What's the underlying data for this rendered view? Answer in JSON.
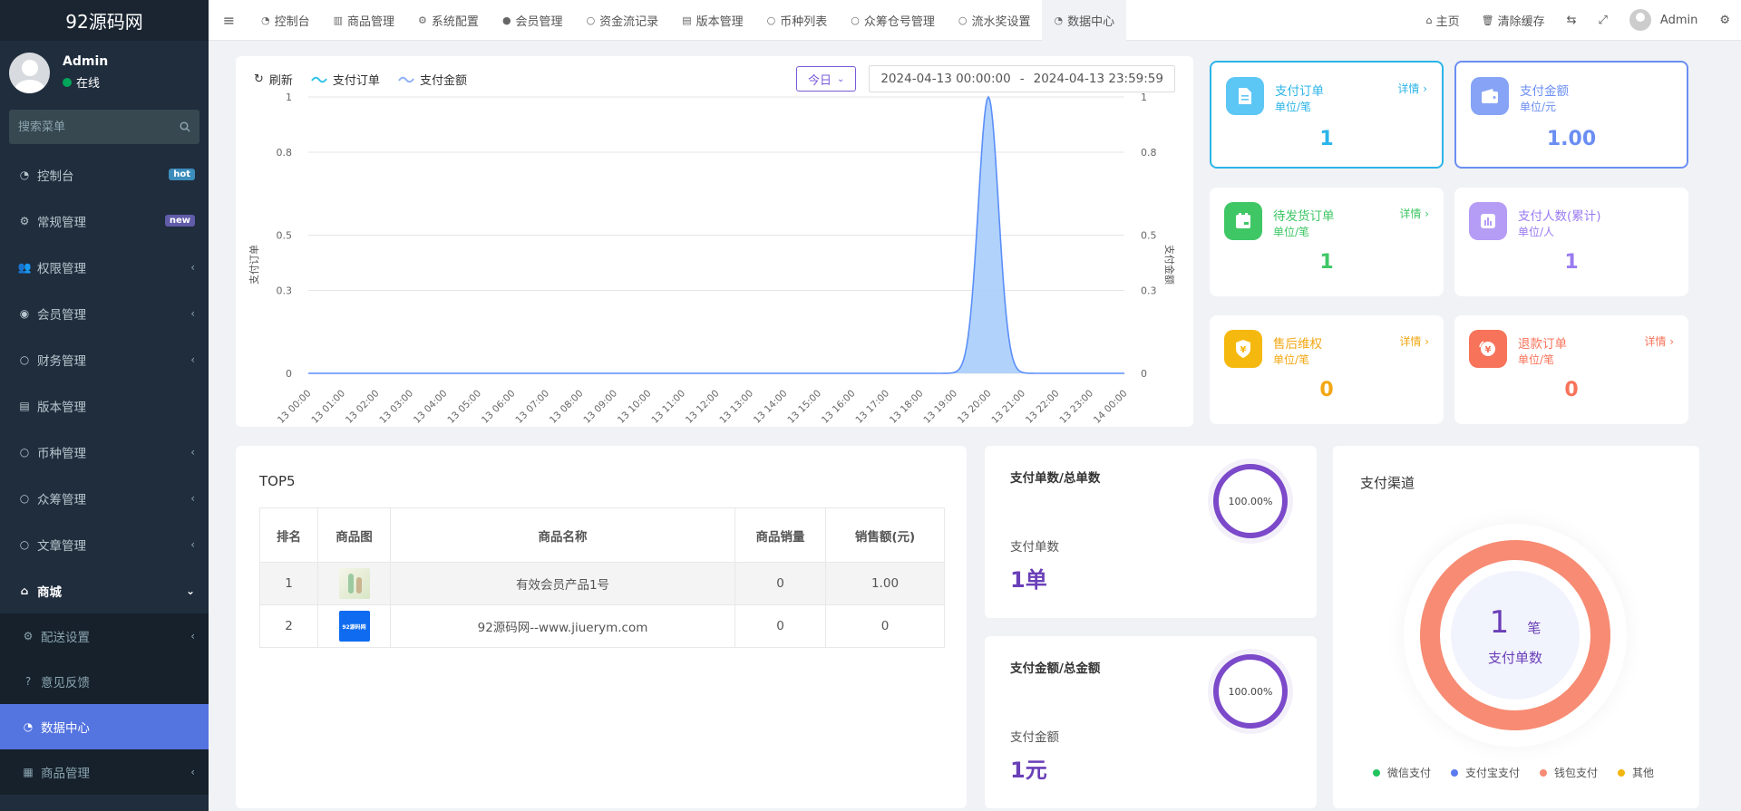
{
  "sidebar": {
    "logo": "92源码网",
    "user": {
      "name": "Admin",
      "status": "在线"
    },
    "search_placeholder": "搜索菜单",
    "items": [
      {
        "label": "控制台",
        "badge": "hot"
      },
      {
        "label": "常规管理",
        "badge": "new"
      },
      {
        "label": "权限管理"
      },
      {
        "label": "会员管理"
      },
      {
        "label": "财务管理"
      },
      {
        "label": "版本管理"
      },
      {
        "label": "币种管理"
      },
      {
        "label": "众筹管理"
      },
      {
        "label": "文章管理"
      },
      {
        "label": "商城"
      }
    ],
    "sub_items": [
      {
        "label": "配送设置"
      },
      {
        "label": "意见反馈"
      },
      {
        "label": "数据中心"
      },
      {
        "label": "商品管理"
      }
    ]
  },
  "navbar": {
    "tabs": [
      "控制台",
      "商品管理",
      "系统配置",
      "会员管理",
      "资金流记录",
      "版本管理",
      "币种列表",
      "众筹仓号管理",
      "流水奖设置",
      "数据中心"
    ],
    "right": {
      "home": "主页",
      "clear_cache": "清除缓存",
      "user": "Admin"
    }
  },
  "chart": {
    "refresh_label": "刷新",
    "legend": [
      "支付订单",
      "支付金额"
    ],
    "period": "今日",
    "date_start": "2024-04-13 00:00:00",
    "date_sep": "-",
    "date_end": "2024-04-13 23:59:59",
    "ylabel_left": "支付订单",
    "ylabel_right": "支付金额"
  },
  "chart_data": {
    "type": "area",
    "x": [
      "13 00:00",
      "13 01:00",
      "13 02:00",
      "13 03:00",
      "13 04:00",
      "13 05:00",
      "13 06:00",
      "13 07:00",
      "13 08:00",
      "13 09:00",
      "13 10:00",
      "13 11:00",
      "13 12:00",
      "13 13:00",
      "13 14:00",
      "13 15:00",
      "13 16:00",
      "13 17:00",
      "13 18:00",
      "13 19:00",
      "13 20:00",
      "13 21:00",
      "13 22:00",
      "13 23:00",
      "14 00:00"
    ],
    "series": [
      {
        "name": "支付订单",
        "values": [
          0,
          0,
          0,
          0,
          0,
          0,
          0,
          0,
          0,
          0,
          0,
          0,
          0,
          0,
          0,
          0,
          0,
          0,
          0,
          0,
          1,
          0,
          0,
          0,
          0
        ]
      },
      {
        "name": "支付金额",
        "values": [
          0,
          0,
          0,
          0,
          0,
          0,
          0,
          0,
          0,
          0,
          0,
          0,
          0,
          0,
          0,
          0,
          0,
          0,
          0,
          0,
          1,
          0,
          0,
          0,
          0
        ]
      }
    ],
    "yticks": [
      "0",
      "0.3",
      "0.5",
      "0.8",
      "1"
    ],
    "ylim": [
      0,
      1
    ],
    "xlabel": "",
    "ylabel": "支付订单",
    "grid": true,
    "colors": {
      "line": "#5b8ff9",
      "fill": "#a9cdfb"
    }
  },
  "stats": [
    {
      "title": "支付订单",
      "unit": "单位/笔",
      "detail": "详情",
      "value": "1",
      "color": "#2bb4e9",
      "icon": "document-icon"
    },
    {
      "title": "支付金额",
      "unit": "单位/元",
      "detail": "",
      "value": "1.00",
      "color": "#6b8ef3",
      "icon": "wallet-icon"
    },
    {
      "title": "待发货订单",
      "unit": "单位/笔",
      "detail": "详情",
      "value": "1",
      "color": "#3fc765",
      "icon": "package-icon"
    },
    {
      "title": "支付人数(累计)",
      "unit": "单位/人",
      "detail": "",
      "value": "1",
      "color": "#9a7bf0",
      "icon": "bar-chart-icon"
    },
    {
      "title": "售后维权",
      "unit": "单位/笔",
      "detail": "详情",
      "value": "0",
      "color": "#f2a713",
      "icon": "shield-yuan-icon"
    },
    {
      "title": "退款订单",
      "unit": "单位/笔",
      "detail": "详情",
      "value": "0",
      "color": "#f7735a",
      "icon": "refund-icon"
    }
  ],
  "top5": {
    "title": "TOP5",
    "headers": [
      "排名",
      "商品图",
      "商品名称",
      "商品销量",
      "销售额(元)"
    ],
    "rows": [
      {
        "rank": "1",
        "name": "有效会员产品1号",
        "sales": "0",
        "amount": "1.00"
      },
      {
        "rank": "2",
        "name": "92源码网--www.jiuerym.com",
        "sales": "0",
        "amount": "0"
      }
    ],
    "thumb2_text": "92源码网"
  },
  "ratio_orders": {
    "title": "支付单数/总单数",
    "percent": "100.00%",
    "label": "支付单数",
    "value": "1单"
  },
  "ratio_amount": {
    "title": "支付金额/总金额",
    "percent": "100.00%",
    "label": "支付金额",
    "value": "1元"
  },
  "channel": {
    "title": "支付渠道",
    "center_value": "1",
    "center_unit": "笔",
    "center_label": "支付单数",
    "legend": [
      {
        "name": "微信支付",
        "color": "#22c45e"
      },
      {
        "name": "支付宝支付",
        "color": "#5b7bf0"
      },
      {
        "name": "钱包支付",
        "color": "#f78b73"
      },
      {
        "name": "其他",
        "color": "#f2b50f"
      }
    ]
  }
}
